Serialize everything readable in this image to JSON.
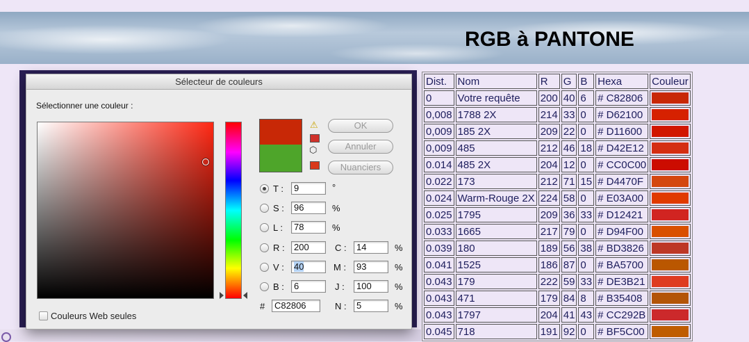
{
  "banner": {
    "title": "RGB à PANTONE"
  },
  "dialog": {
    "title": "Sélecteur de couleurs",
    "select_label": "Sélectionner une couleur :",
    "buttons": {
      "ok": "OK",
      "cancel": "Annuler",
      "swatches": "Nuanciers"
    },
    "current_color": "#c82806",
    "previous_color": "#4ea52a",
    "warn_swatch_color": "#d0322a",
    "cube_swatch_color": "#d8381a",
    "hsb": {
      "h_label": "T :",
      "h_value": "9",
      "h_unit": "°",
      "s_label": "S :",
      "s_value": "96",
      "s_unit": "%",
      "b_label": "L :",
      "b_value": "78",
      "b_unit": "%"
    },
    "rgb": {
      "r_label": "R :",
      "r_value": "200",
      "g_label": "V :",
      "g_value": "40",
      "b_label": "B :",
      "b_value": "6"
    },
    "cmyk": {
      "c_label": "C :",
      "c_value": "14",
      "c_unit": "%",
      "m_label": "M :",
      "m_value": "93",
      "m_unit": "%",
      "y_label": "J :",
      "y_value": "100",
      "y_unit": "%",
      "k_label": "N :",
      "k_value": "5",
      "k_unit": "%"
    },
    "hex_label": "#",
    "hex_value": "C82806",
    "web_only_label": "Couleurs Web seules"
  },
  "table": {
    "headers": [
      "Dist.",
      "Nom",
      "R",
      "G",
      "B",
      "Hexa",
      "Couleur"
    ],
    "rows": [
      [
        "0",
        "Votre requête",
        "200",
        "40",
        "6",
        "# C82806",
        "#C82806"
      ],
      [
        "0,008",
        "1788 2X",
        "214",
        "33",
        "0",
        "# D62100",
        "#D62100"
      ],
      [
        "0,009",
        "185 2X",
        "209",
        "22",
        "0",
        "# D11600",
        "#D11600"
      ],
      [
        "0,009",
        "485",
        "212",
        "46",
        "18",
        "# D42E12",
        "#D42E12"
      ],
      [
        "0.014",
        "485 2X",
        "204",
        "12",
        "0",
        "# CC0C00",
        "#CC0C00"
      ],
      [
        "0.022",
        "173",
        "212",
        "71",
        "15",
        "# D4470F",
        "#D4470F"
      ],
      [
        "0.024",
        "Warm-Rouge 2X",
        "224",
        "58",
        "0",
        "# E03A00",
        "#E03A00"
      ],
      [
        "0.025",
        "1795",
        "209",
        "36",
        "33",
        "# D12421",
        "#D12421"
      ],
      [
        "0.033",
        "1665",
        "217",
        "79",
        "0",
        "# D94F00",
        "#D94F00"
      ],
      [
        "0.039",
        "180",
        "189",
        "56",
        "38",
        "# BD3826",
        "#BD3826"
      ],
      [
        "0.041",
        "1525",
        "186",
        "87",
        "0",
        "# BA5700",
        "#BA5700"
      ],
      [
        "0.043",
        "179",
        "222",
        "59",
        "33",
        "# DE3B21",
        "#DE3B21"
      ],
      [
        "0.043",
        "471",
        "179",
        "84",
        "8",
        "# B35408",
        "#B35408"
      ],
      [
        "0.043",
        "1797",
        "204",
        "41",
        "43",
        "# CC292B",
        "#CC292B"
      ],
      [
        "0.045",
        "718",
        "191",
        "92",
        "0",
        "# BF5C00",
        "#BF5C00"
      ]
    ]
  }
}
